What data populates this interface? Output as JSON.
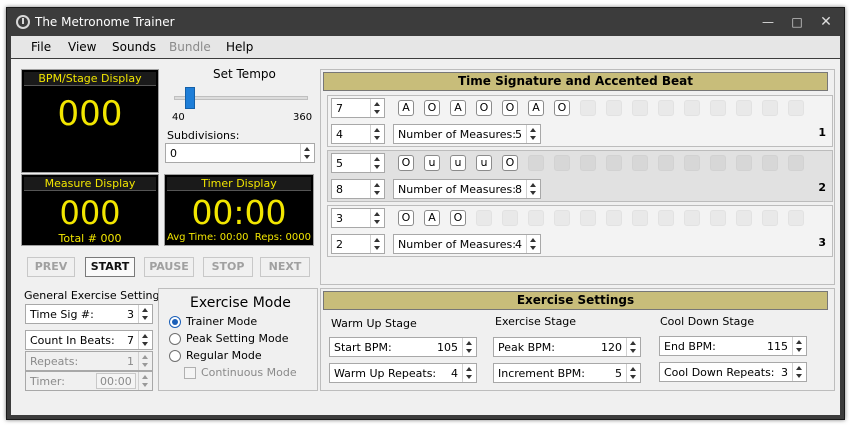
{
  "window": {
    "title": "The Metronome Trainer"
  },
  "menu": [
    "File",
    "View",
    "Sounds",
    "Bundle",
    "Help"
  ],
  "bpm_display": {
    "header": "BPM/Stage Display",
    "value": "000"
  },
  "tempo": {
    "label": "Set Tempo",
    "min": "40",
    "max": "360",
    "position": 0.09
  },
  "subdivisions": {
    "label": "Subdivisions:",
    "value": "0"
  },
  "measure_display": {
    "header": "Measure Display",
    "value": "000",
    "total": "Total # 000"
  },
  "timer_display": {
    "header": "Timer Display",
    "value": "00:00",
    "avg": "Avg Time: 00:00",
    "reps": "Reps: 0000"
  },
  "transport": {
    "prev": "PREV",
    "start": "START",
    "pause": "PAUSE",
    "stop": "STOP",
    "next": "NEXT"
  },
  "general": {
    "title": "General Exercise Settings",
    "time_sig_label": "Time Sig #:",
    "time_sig_value": "3",
    "count_in_label": "Count In Beats:",
    "count_in_value": "7",
    "repeats_label": "Repeats:",
    "repeats_value": "1",
    "timer_label": "Timer:",
    "timer_value": "00:00"
  },
  "mode": {
    "title": "Exercise Mode",
    "options": [
      "Trainer Mode",
      "Peak Setting Mode",
      "Regular Mode"
    ],
    "selected": "Trainer Mode",
    "continuous": "Continuous Mode"
  },
  "time_signature": {
    "title": "Time Signature and Accented Beat",
    "measures_label": "Number of Measures:",
    "rows": [
      {
        "num": "1",
        "top": "7",
        "bottom": "4",
        "measures": "5",
        "beats": [
          "A",
          "O",
          "A",
          "O",
          "O",
          "A",
          "O"
        ]
      },
      {
        "num": "2",
        "top": "5",
        "bottom": "8",
        "measures": "8",
        "beats": [
          "O",
          "u",
          "u",
          "u",
          "O"
        ]
      },
      {
        "num": "3",
        "top": "3",
        "bottom": "2",
        "measures": "4",
        "beats": [
          "O",
          "A",
          "O"
        ]
      }
    ]
  },
  "exercise": {
    "title": "Exercise Settings",
    "warm_up": {
      "title": "Warm Up Stage",
      "start_label": "Start BPM:",
      "start_value": "105",
      "repeats_label": "Warm Up Repeats:",
      "repeats_value": "4"
    },
    "exercise_stage": {
      "title": "Exercise Stage",
      "peak_label": "Peak BPM:",
      "peak_value": "120",
      "increment_label": "Increment BPM:",
      "increment_value": "5"
    },
    "cool_down": {
      "title": "Cool Down Stage",
      "end_label": "End BPM:",
      "end_value": "115",
      "repeats_label": "Cool Down Repeats:",
      "repeats_value": "3"
    }
  },
  "colors": {
    "lcd_text": "#f2e600",
    "lcd_bg": "#000000",
    "header_gold": "#c8bd7a",
    "accent_radio": "#1b5fb8"
  }
}
